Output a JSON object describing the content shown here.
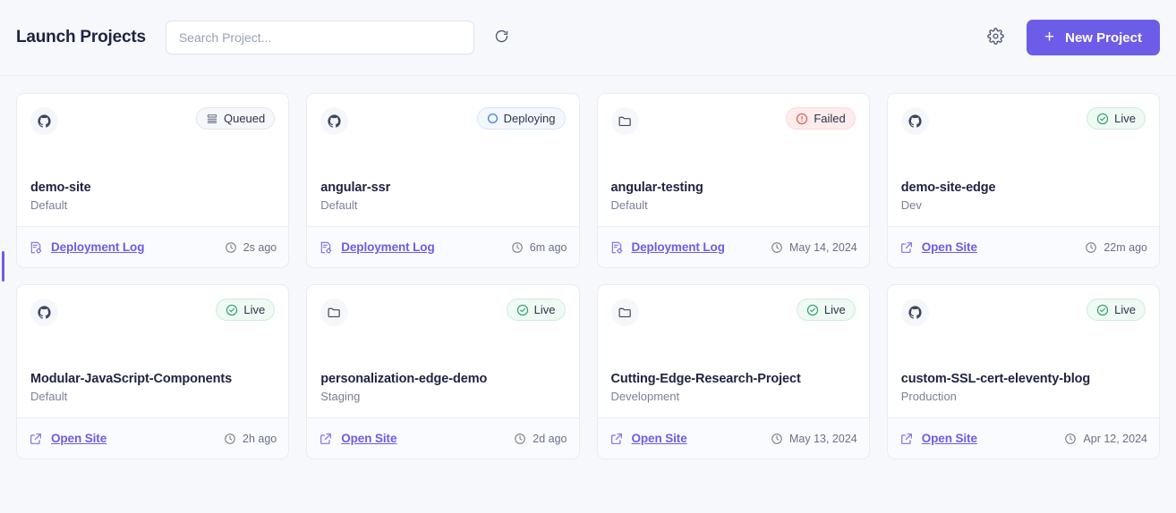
{
  "header": {
    "title": "Launch Projects",
    "search": {
      "value": "",
      "placeholder": "Search Project..."
    },
    "refresh_icon": "refresh-icon",
    "settings_icon": "gear-icon",
    "new_project": {
      "label": "New Project",
      "plus": "+",
      "accent_color": "#6c5ce7"
    }
  },
  "status_colors": {
    "live": "#2e9e6b",
    "failed": "#e1544a",
    "deploying": "#3b7ddd",
    "queued": "#6a7088"
  },
  "projects": [
    {
      "name": "demo-site",
      "env": "Default",
      "source_icon": "github-icon",
      "status": {
        "label": "Queued",
        "kind": "queued",
        "icon": "layers-icon"
      },
      "action": {
        "label": "Deployment Log",
        "icon": "deployment-log-icon"
      },
      "time": {
        "label": "2s ago",
        "icon": "clock-icon"
      }
    },
    {
      "name": "angular-ssr",
      "env": "Default",
      "source_icon": "github-icon",
      "status": {
        "label": "Deploying",
        "kind": "deploying",
        "icon": "circle-icon"
      },
      "action": {
        "label": "Deployment Log",
        "icon": "deployment-log-icon"
      },
      "time": {
        "label": "6m ago",
        "icon": "clock-icon"
      }
    },
    {
      "name": "angular-testing",
      "env": "Default",
      "source_icon": "folder-icon",
      "status": {
        "label": "Failed",
        "kind": "failed",
        "icon": "alert-circle-icon"
      },
      "action": {
        "label": "Deployment Log",
        "icon": "deployment-log-icon"
      },
      "time": {
        "label": "May 14, 2024",
        "icon": "clock-icon"
      }
    },
    {
      "name": "demo-site-edge",
      "env": "Dev",
      "source_icon": "github-icon",
      "status": {
        "label": "Live",
        "kind": "live",
        "icon": "check-circle-icon"
      },
      "action": {
        "label": "Open Site",
        "icon": "external-link-icon"
      },
      "time": {
        "label": "22m ago",
        "icon": "clock-icon"
      }
    },
    {
      "name": "Modular-JavaScript-Components",
      "env": "Default",
      "source_icon": "github-icon",
      "status": {
        "label": "Live",
        "kind": "live",
        "icon": "check-circle-icon"
      },
      "action": {
        "label": "Open Site",
        "icon": "external-link-icon"
      },
      "time": {
        "label": "2h ago",
        "icon": "clock-icon"
      }
    },
    {
      "name": "personalization-edge-demo",
      "env": "Staging",
      "source_icon": "folder-icon",
      "status": {
        "label": "Live",
        "kind": "live",
        "icon": "check-circle-icon"
      },
      "action": {
        "label": "Open Site",
        "icon": "external-link-icon"
      },
      "time": {
        "label": "2d ago",
        "icon": "clock-icon"
      }
    },
    {
      "name": "Cutting-Edge-Research-Project",
      "env": "Development",
      "source_icon": "folder-icon",
      "status": {
        "label": "Live",
        "kind": "live",
        "icon": "check-circle-icon"
      },
      "action": {
        "label": "Open Site",
        "icon": "external-link-icon"
      },
      "time": {
        "label": "May 13, 2024",
        "icon": "clock-icon"
      }
    },
    {
      "name": "custom-SSL-cert-eleventy-blog",
      "env": "Production",
      "source_icon": "github-icon",
      "status": {
        "label": "Live",
        "kind": "live",
        "icon": "check-circle-icon"
      },
      "action": {
        "label": "Open Site",
        "icon": "external-link-icon"
      },
      "time": {
        "label": "Apr 12, 2024",
        "icon": "clock-icon"
      }
    }
  ]
}
